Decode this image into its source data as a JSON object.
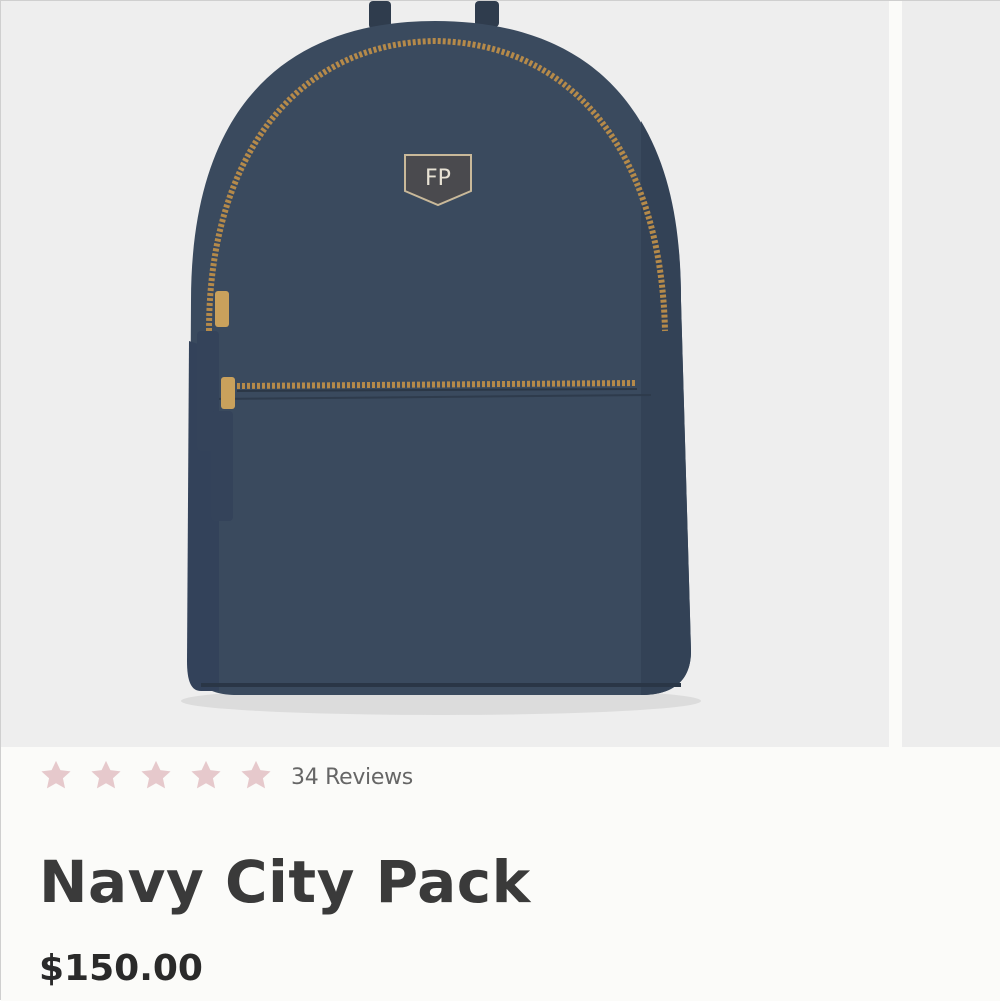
{
  "product": {
    "name": "Navy City Pack",
    "price": "$150.00",
    "reviews_label": "34 Reviews",
    "rating": 5,
    "rating_max": 5,
    "star_color": "#e6c9cc",
    "logo_text": "FP"
  },
  "gallery": {
    "main_image": "navy-backpack-photo",
    "next_image": "partial-next-photo"
  },
  "colors": {
    "bag": "#3a4a5e",
    "zipper": "#b58a4a",
    "background": "#eeeeee",
    "panel": "#fbfbf9"
  }
}
